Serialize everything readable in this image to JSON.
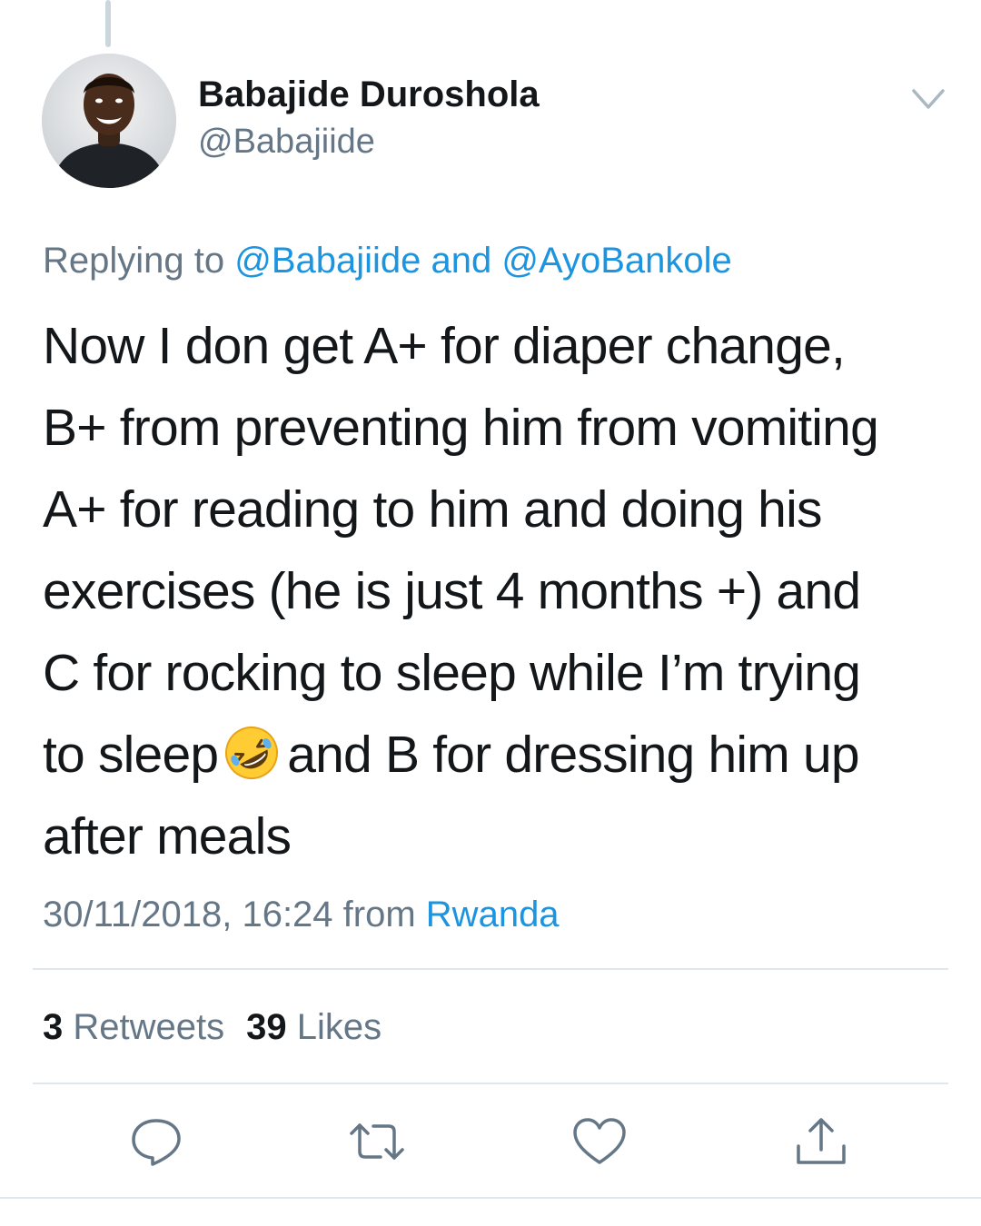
{
  "author": {
    "display_name": "Babajide Duroshola",
    "handle": "@Babajiide"
  },
  "reply_context": {
    "prefix": "Replying to ",
    "mention_1": "@Babajiide",
    "conjunction": " and ",
    "mention_2": "@AyoBankole"
  },
  "tweet": {
    "lines": [
      "Now I don get A+ for diaper change,",
      "B+ from preventing him from vomiting",
      "A+ for reading to him and doing his",
      "exercises (he is just 4 months +) and",
      "C for rocking to sleep while I’m trying",
      "to sleep",
      "and B for dressing him up",
      "after meals"
    ],
    "emoji": "rolling-on-the-floor-laughing"
  },
  "meta": {
    "timestamp": "30/11/2018, 16:24",
    "from_label": " from ",
    "location": "Rwanda"
  },
  "stats": {
    "retweets_count": "3",
    "retweets_label": "Retweets",
    "likes_count": "39",
    "likes_label": "Likes"
  },
  "actions": {
    "icons": [
      "reply-icon",
      "retweet-icon",
      "like-icon",
      "share-icon"
    ]
  },
  "colors": {
    "text": "#14171a",
    "secondary": "#657786",
    "link": "#1b95e0",
    "divider": "#e1e8ed"
  }
}
